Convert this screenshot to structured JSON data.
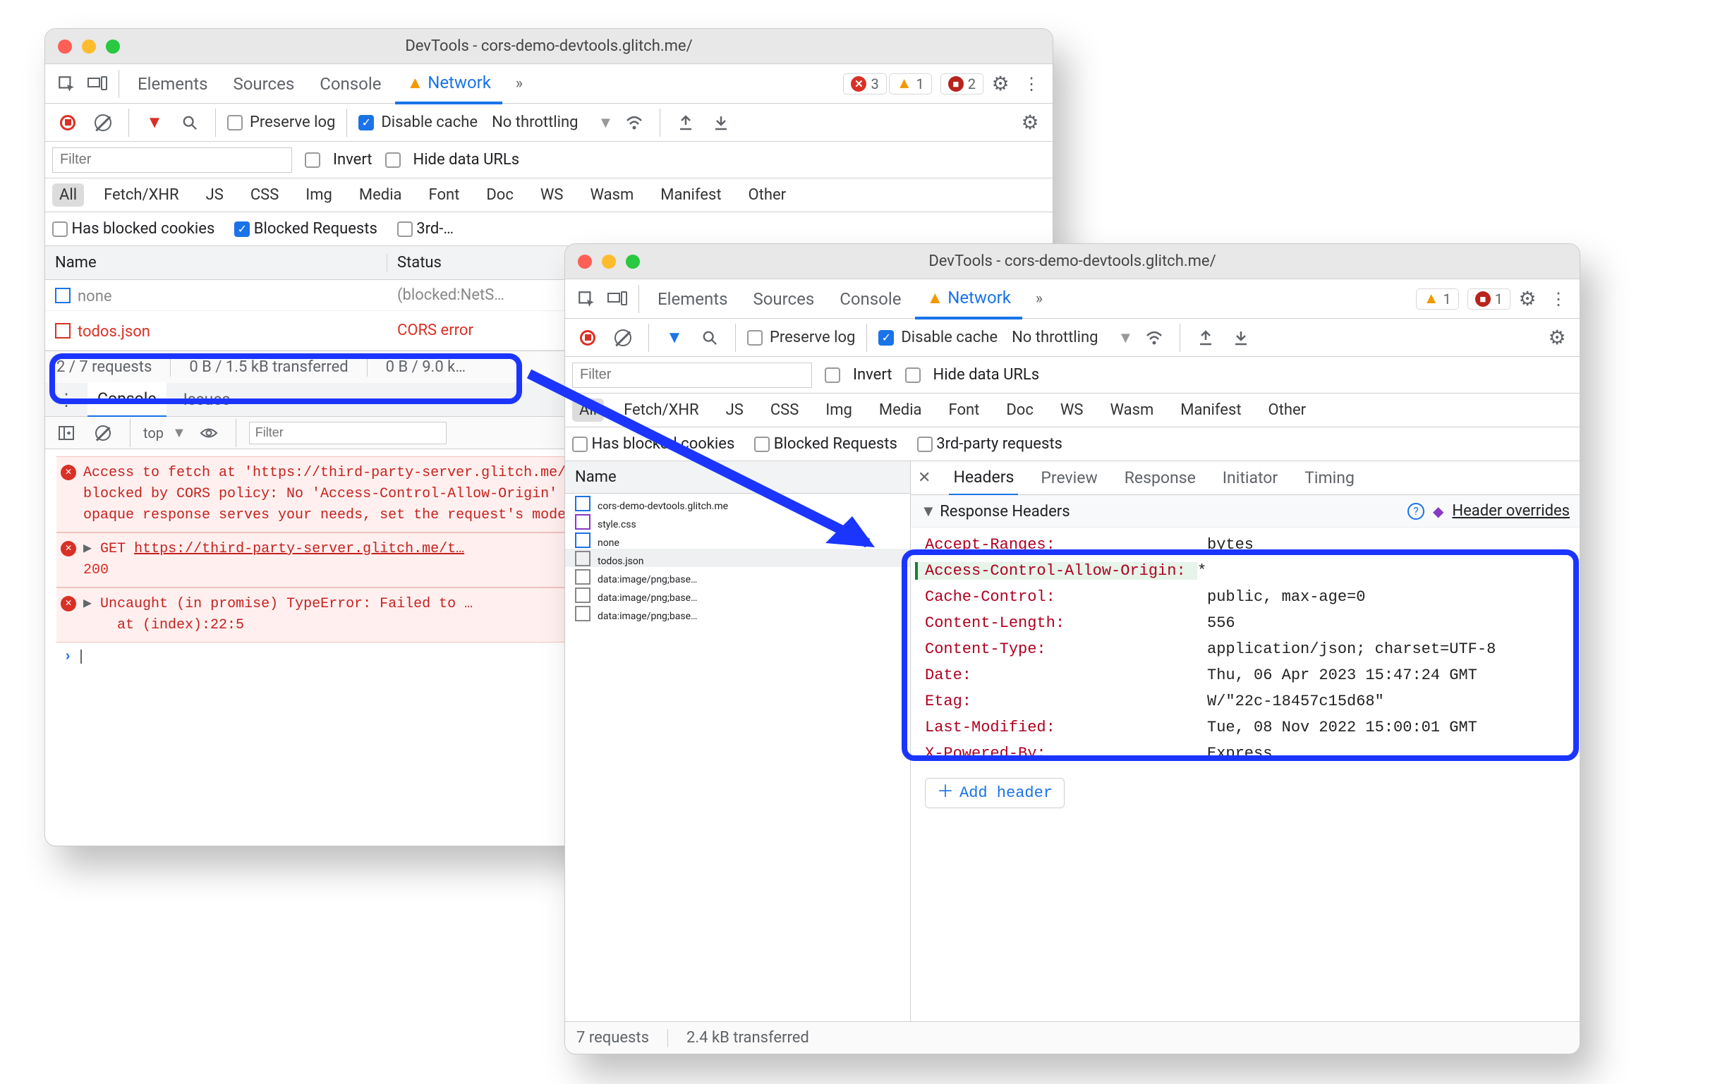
{
  "left": {
    "title": "DevTools - cors-demo-devtools.glitch.me/",
    "tabs": [
      "Elements",
      "Sources",
      "Console",
      "Network"
    ],
    "activeTab": "Network",
    "badges": {
      "errors": "3",
      "warnings": "1",
      "issues": "2"
    },
    "toolbar": {
      "preserveLog": "Preserve log",
      "disableCache": "Disable cache",
      "throttling": "No throttling"
    },
    "filterPlaceholder": "Filter",
    "invert": "Invert",
    "hideDataUrls": "Hide data URLs",
    "chips": [
      "All",
      "Fetch/XHR",
      "JS",
      "CSS",
      "Img",
      "Media",
      "Font",
      "Doc",
      "WS",
      "Wasm",
      "Manifest",
      "Other"
    ],
    "opts": {
      "blockedCookies": "Has blocked cookies",
      "blockedRequests": "Blocked Requests",
      "thirdParty": "3rd-…"
    },
    "table": {
      "headers": [
        "Name",
        "Status"
      ],
      "rowHidden": {
        "name": "none",
        "status": "(blocked:NetS…"
      },
      "rowCors": {
        "name": "todos.json",
        "status": "CORS error"
      }
    },
    "statusbar": [
      "2 / 7 requests",
      "0 B / 1.5 kB transferred",
      "0 B / 9.0 k…"
    ],
    "drawerTabs": [
      "Console",
      "Issues"
    ],
    "console": {
      "scope": "top",
      "filterPlaceholder": "Filter",
      "msg1": "Access to fetch at 'https://third-party-server.glitch.me/todos.json' from origin 'https://cors-…' has been blocked by CORS policy: No 'Access-Control-Allow-Origin' header is present on the requested resource. If an opaque response serves your needs, set the request's mode to 'no-cors' to fetch the resource with CORS disabled.",
      "msg2a": "GET ",
      "msg2link": "https://third-party-server.glitch.me/t…",
      "msg2b": "200",
      "msg3a": "Uncaught (in promise) TypeError: Failed to …",
      "msg3b": "at (index):22:5"
    }
  },
  "right": {
    "title": "DevTools - cors-demo-devtools.glitch.me/",
    "tabs": [
      "Elements",
      "Sources",
      "Console",
      "Network"
    ],
    "activeTab": "Network",
    "badges": {
      "warnings": "1",
      "issues": "1"
    },
    "toolbar": {
      "preserveLog": "Preserve log",
      "disableCache": "Disable cache",
      "throttling": "No throttling"
    },
    "filterPlaceholder": "Filter",
    "invert": "Invert",
    "hideDataUrls": "Hide data URLs",
    "chips": [
      "All",
      "Fetch/XHR",
      "JS",
      "CSS",
      "Img",
      "Media",
      "Font",
      "Doc",
      "WS",
      "Wasm",
      "Manifest",
      "Other"
    ],
    "opts": {
      "blockedCookies": "Has blocked cookies",
      "blockedRequests": "Blocked Requests",
      "thirdParty": "3rd-party requests"
    },
    "table": {
      "header": "Name",
      "rows": [
        {
          "icon": "doc",
          "name": "cors-demo-devtools.glitch.me"
        },
        {
          "icon": "css",
          "name": "style.css"
        },
        {
          "icon": "doc",
          "name": "none"
        },
        {
          "icon": "gen",
          "name": "todos.json",
          "sel": true
        },
        {
          "icon": "gen",
          "name": "data:image/png;base…"
        },
        {
          "icon": "gen",
          "name": "data:image/png;base…"
        },
        {
          "icon": "gen",
          "name": "data:image/png;base…"
        }
      ]
    },
    "panelTabs": [
      "Headers",
      "Preview",
      "Response",
      "Initiator",
      "Timing"
    ],
    "sectionTitle": "Response Headers",
    "headerOverrides": "Header overrides",
    "headers": [
      {
        "k": "Accept-Ranges:",
        "v": "bytes"
      },
      {
        "k": "Access-Control-Allow-Origin:",
        "v": "*",
        "green": true
      },
      {
        "k": "Cache-Control:",
        "v": "public, max-age=0"
      },
      {
        "k": "Content-Length:",
        "v": "556"
      },
      {
        "k": "Content-Type:",
        "v": "application/json; charset=UTF-8"
      },
      {
        "k": "Date:",
        "v": "Thu, 06 Apr 2023 15:47:24 GMT"
      },
      {
        "k": "Etag:",
        "v": "W/\"22c-18457c15d68\""
      },
      {
        "k": "Last-Modified:",
        "v": "Tue, 08 Nov 2022 15:00:01 GMT"
      },
      {
        "k": "X-Powered-By:",
        "v": "Express"
      }
    ],
    "addHeader": "Add header",
    "statusbar": [
      "7 requests",
      "2.4 kB transferred"
    ]
  }
}
